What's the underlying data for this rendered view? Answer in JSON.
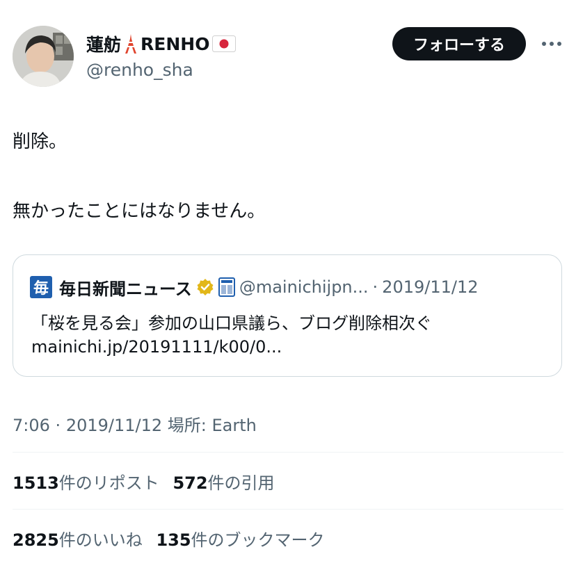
{
  "user": {
    "display_name": "蓮舫",
    "display_name_latin": "RENHO",
    "handle": "@renho_sha",
    "name_emojis": [
      "tokyo-tower",
      "japan-flag"
    ]
  },
  "follow_button_label": "フォローする",
  "more_icon": "more-dots",
  "tweet_lines": [
    "削除。",
    "無かったことにはなりません。"
  ],
  "quote": {
    "logo_char": "毎",
    "source_name": "毎日新聞ニュース",
    "verified_badge_color": "#e2b719",
    "handle": "@mainichijpn...",
    "dot": "·",
    "date": "2019/11/12",
    "text": "「桜を見る会」参加の山口県議ら、ブログ削除相次ぐ",
    "link": "mainichi.jp/20191111/k00/0..."
  },
  "meta": {
    "time": "7:06",
    "dot": "·",
    "date": "2019/11/12",
    "location_label": "場所: Earth"
  },
  "stats": {
    "reposts": {
      "count": "1513",
      "label": "件のリポスト"
    },
    "quotes": {
      "count": "572",
      "label": "件の引用"
    },
    "likes": {
      "count": "2825",
      "label": "件のいいね"
    },
    "bookmarks": {
      "count": "135",
      "label": "件のブックマーク"
    }
  },
  "colors": {
    "follow_button_bg": "#0f1419",
    "secondary_text": "#536471",
    "border": "#cfd9de",
    "mainichi_blue": "#1f5fae"
  }
}
